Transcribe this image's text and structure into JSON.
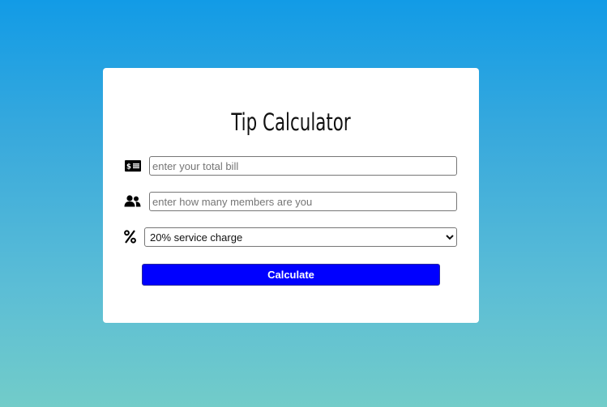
{
  "app": {
    "title": "Tip Calculator"
  },
  "form": {
    "bill": {
      "icon": "money-bill-icon",
      "placeholder": "enter your total bill",
      "value": ""
    },
    "members": {
      "icon": "users-icon",
      "placeholder": "enter how many members are you",
      "value": ""
    },
    "service": {
      "icon": "percent-icon",
      "selected": "20% service charge",
      "options": [
        "20% service charge"
      ]
    },
    "calculate_label": "Calculate"
  },
  "colors": {
    "background_top": "#129be6",
    "background_bottom": "#72ccc9",
    "button": "#0000ff",
    "card": "#ffffff"
  }
}
